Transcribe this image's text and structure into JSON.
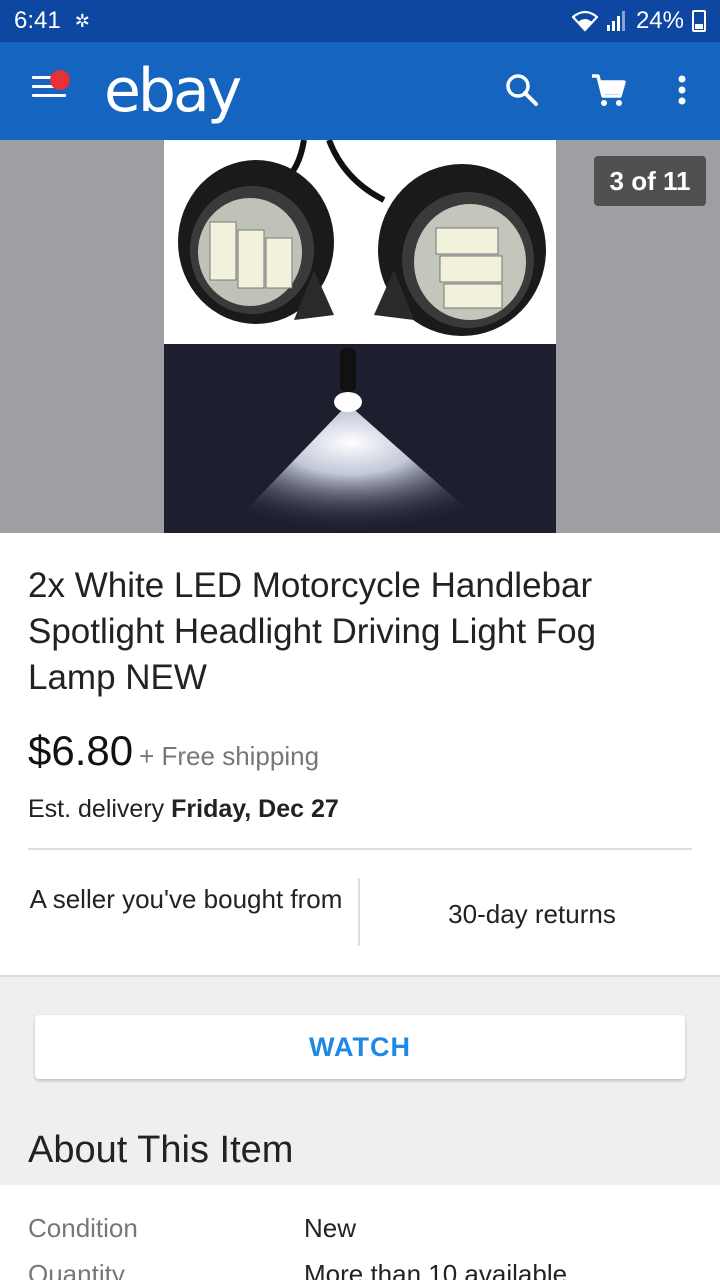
{
  "status_bar": {
    "time": "6:41",
    "battery": "24%"
  },
  "app_bar": {
    "logo": "ebay"
  },
  "gallery": {
    "counter": "3 of 11"
  },
  "item": {
    "title": "2x White LED Motorcycle Handlebar Spotlight Headlight Driving Light Fog Lamp NEW",
    "price": "$6.80",
    "shipping": "+ Free shipping",
    "delivery_prefix": "Est. delivery",
    "delivery_date": "Friday, Dec 27",
    "perk_seller": "A seller you've bought from",
    "perk_returns": "30-day returns"
  },
  "actions": {
    "watch_label": "WATCH"
  },
  "about": {
    "heading": "About This Item",
    "specs": [
      {
        "label": "Condition",
        "value": "New"
      },
      {
        "label": "Quantity",
        "value": "More than 10 available"
      }
    ]
  },
  "colors": {
    "status_bar": "#0d47a1",
    "app_bar": "#1565c0",
    "accent": "#1e88e5",
    "notification": "#e53238"
  }
}
